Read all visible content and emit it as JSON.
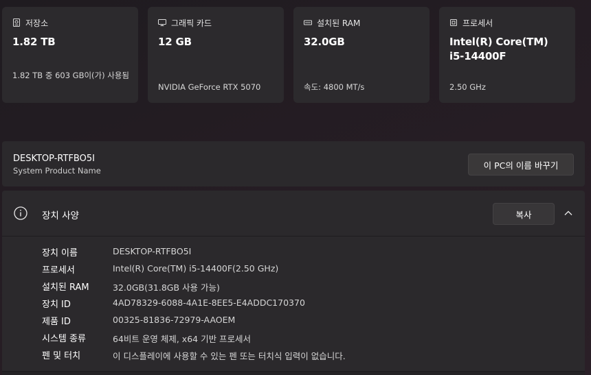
{
  "cards": [
    {
      "label": "저장소",
      "icon": "drive-icon",
      "value": "1.82 TB",
      "sub": "1.82 TB 중 603 GB이(가) 사용됨"
    },
    {
      "label": "그래픽 카드",
      "icon": "monitor-icon",
      "value": "12 GB",
      "sub": "NVIDIA GeForce RTX 5070"
    },
    {
      "label": "설치된 RAM",
      "icon": "ram-icon",
      "value": "32.0GB",
      "sub": "속도: 4800 MT/s"
    },
    {
      "label": "프로세서",
      "icon": "cpu-icon",
      "value": "Intel(R) Core(TM) i5-14400F",
      "sub": "2.50 GHz"
    }
  ],
  "device": {
    "name": "DESKTOP-RTFBO5I",
    "subtitle": "System Product Name",
    "rename_label": "이 PC의 이름 바꾸기"
  },
  "specs": {
    "title": "장치 사양",
    "copy_label": "복사",
    "rows": [
      {
        "key": "장치 이름",
        "value": "DESKTOP-RTFBO5I"
      },
      {
        "key": "프로세서",
        "value": "Intel(R) Core(TM) i5-14400F(2.50 GHz)"
      },
      {
        "key": "설치된 RAM",
        "value": "32.0GB(31.8GB 사용 가능)"
      },
      {
        "key": "장치 ID",
        "value": "4AD78329-6088-4A1E-8EE5-E4ADDC170370"
      },
      {
        "key": "제품 ID",
        "value": "00325-81836-72979-AAOEM"
      },
      {
        "key": "시스템 종류",
        "value": "64비트 운영 체제, x64 기반 프로세서"
      },
      {
        "key": "펜 및 터치",
        "value": "이 디스플레이에 사용할 수 있는 펜 또는 터치식 입력이 없습니다."
      }
    ]
  }
}
